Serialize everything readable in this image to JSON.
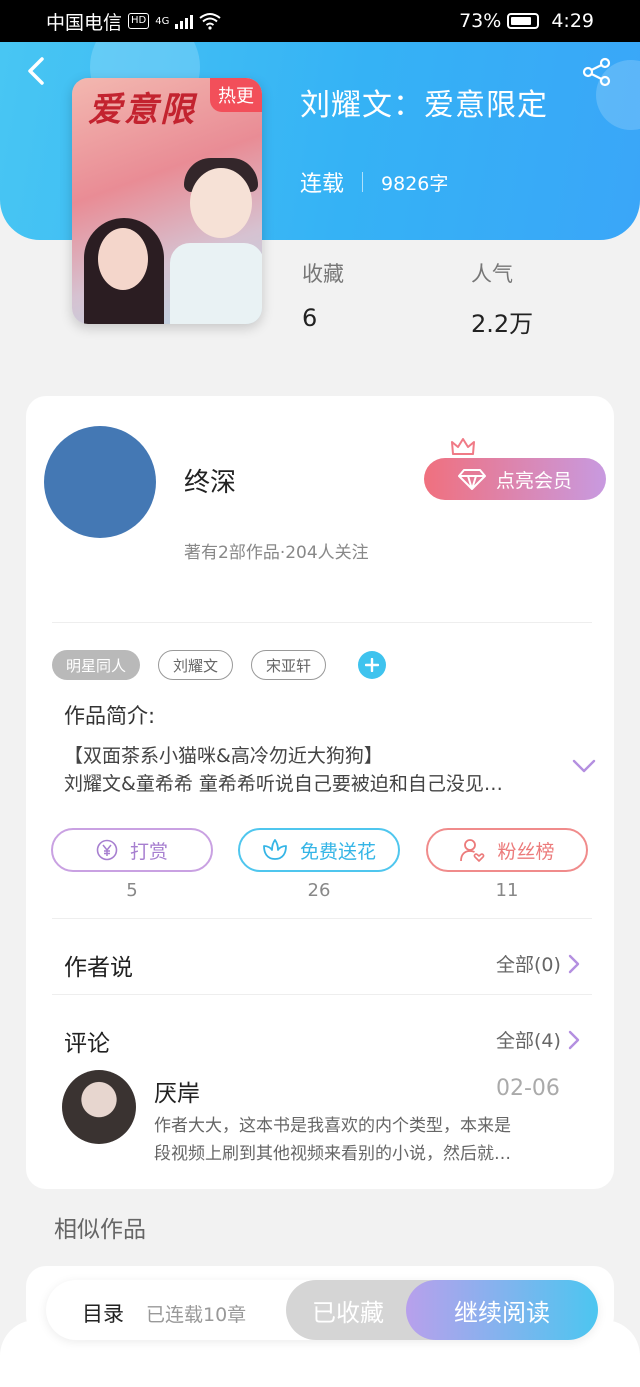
{
  "status_bar": {
    "carrier": "中国电信",
    "hd": "HD",
    "network": "4G",
    "battery": "73%",
    "time": "4:29"
  },
  "book": {
    "cover_title": "爱意限",
    "cover_badge": "热更",
    "title": "刘耀文：爱意限定",
    "status": "连载",
    "word_count": "9826字"
  },
  "stats": {
    "favorites_label": "收藏",
    "favorites_value": "6",
    "popularity_label": "人气",
    "popularity_value": "2.2万"
  },
  "author": {
    "name": "终深",
    "meta": "著有2部作品·204人关注",
    "vip_label": "点亮会员"
  },
  "tags": [
    "明星同人",
    "刘耀文",
    "宋亚轩"
  ],
  "intro": {
    "title": "作品简介:",
    "line1": "【双面茶系小猫咪&高冷勿近大狗狗】",
    "line2": "刘耀文&童希希  童希希听说自己要被迫和自己没见…"
  },
  "actions": {
    "tip_label": "打赏",
    "tip_count": "5",
    "flower_label": "免费送花",
    "flower_count": "26",
    "fans_label": "粉丝榜",
    "fans_count": "11"
  },
  "author_says": {
    "title": "作者说",
    "more": "全部(0)"
  },
  "comments": {
    "title": "评论",
    "more": "全部(4)",
    "item": {
      "user": "厌岸",
      "date": "02-06",
      "line1": "作者大大，这本书是我喜欢的内个类型，本来是",
      "line2": "段视频上刷到其他视频来看别的小说，然后就…"
    }
  },
  "similar": {
    "title": "相似作品"
  },
  "bottom_bar": {
    "toc_label": "目录",
    "chapters": "已连载10章",
    "collected_label": "已收藏",
    "continue_label": "继续阅读"
  },
  "colors": {
    "header_gradient_start": "#48c6f3",
    "header_gradient_end": "#3aa6f8",
    "author_avatar": "#4478b4",
    "tag_add": "#3fc3ee"
  },
  "icons": [
    "back-arrow-icon",
    "share-icon",
    "crown-icon",
    "diamond-icon",
    "yen-icon",
    "flower-icon",
    "user-heart-icon",
    "chevron-right-icon",
    "chevron-down-icon",
    "plus-icon"
  ]
}
